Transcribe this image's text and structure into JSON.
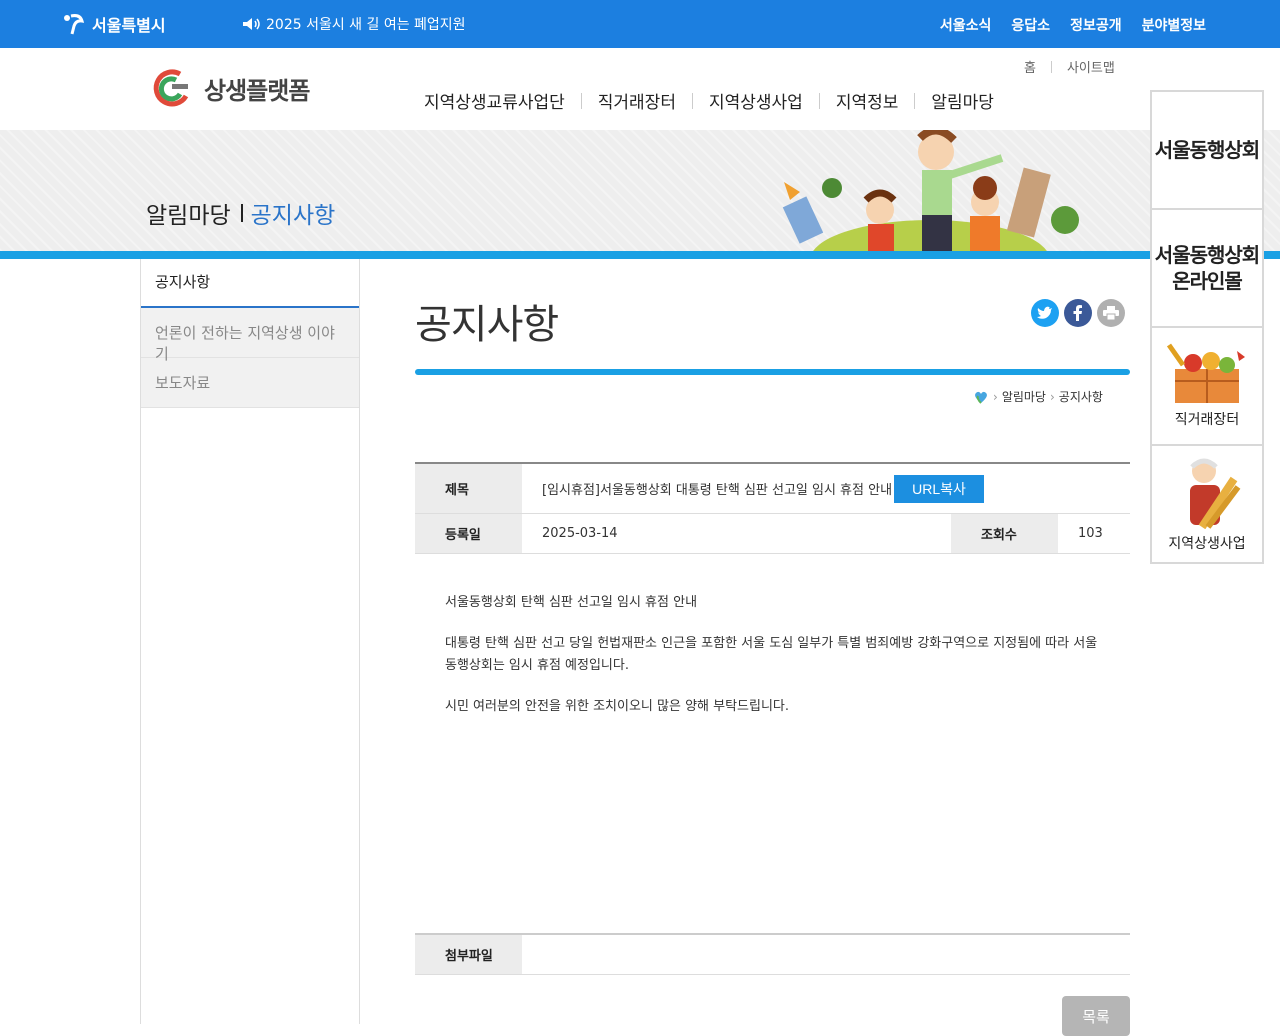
{
  "topbar": {
    "city_name": "서울특별시",
    "notice": "2025 서울시 새 길 여는 폐업지원",
    "links": [
      "서울소식",
      "응답소",
      "정보공개",
      "분야별정보"
    ]
  },
  "header": {
    "logo_text": "상생플랫폼",
    "util": [
      "홈",
      "사이트맵"
    ],
    "gnb": [
      "지역상생교류사업단",
      "직거래장터",
      "지역상생사업",
      "지역정보",
      "알림마당"
    ]
  },
  "banner": {
    "section": "알림마당",
    "current": "공지사항"
  },
  "quick_menu": {
    "item1": "서울동행상회",
    "item2_line1": "서울동행상회",
    "item2_line2": "온라인몰",
    "item3": "직거래장터",
    "item4": "지역상생사업"
  },
  "lnb": {
    "head": "공지사항",
    "items": [
      "언론이 전하는 지역상생 이야기",
      "보도자료"
    ]
  },
  "page": {
    "title": "공지사항",
    "breadcrumb": [
      "알림마당",
      "공지사항"
    ]
  },
  "board": {
    "subject_label": "제목",
    "subject": "[임시휴점]서울동행상회 대통령 탄핵 심판 선고일 임시 휴점 안내",
    "url_copy": "URL복사",
    "date_label": "등록일",
    "date": "2025-03-14",
    "views_label": "조회수",
    "views": "103",
    "body": [
      "서울동행상회 탄핵 심판 선고일 임시 휴점 안내",
      "대통령 탄핵 심판 선고 당일 헌법재판소 인근을 포함한 서울 도심 일부가 특별 범죄예방 강화구역으로 지정됨에 따라 서울동행상회는 임시 휴점 예정입니다.",
      "시민 여러분의 안전을 위한 조치이오니 많은 양해 부탁드립니다."
    ],
    "attach_label": "첨부파일",
    "list_button": "목록"
  },
  "colors": {
    "topbar": "#1c7fe0",
    "accent_line": "#1aa0e4",
    "link_blue": "#2a74c9",
    "twitter": "#1da1f2",
    "facebook": "#3b5998",
    "print": "#b0b0b0"
  }
}
